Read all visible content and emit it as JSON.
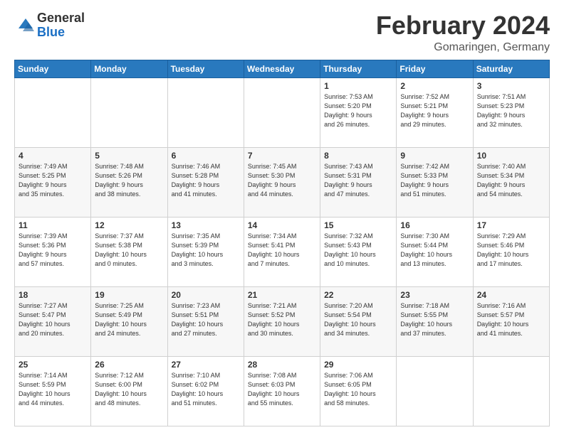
{
  "header": {
    "logo_general": "General",
    "logo_blue": "Blue",
    "title": "February 2024",
    "subtitle": "Gomaringen, Germany"
  },
  "columns": [
    "Sunday",
    "Monday",
    "Tuesday",
    "Wednesday",
    "Thursday",
    "Friday",
    "Saturday"
  ],
  "weeks": [
    [
      {
        "day": "",
        "info": ""
      },
      {
        "day": "",
        "info": ""
      },
      {
        "day": "",
        "info": ""
      },
      {
        "day": "",
        "info": ""
      },
      {
        "day": "1",
        "info": "Sunrise: 7:53 AM\nSunset: 5:20 PM\nDaylight: 9 hours\nand 26 minutes."
      },
      {
        "day": "2",
        "info": "Sunrise: 7:52 AM\nSunset: 5:21 PM\nDaylight: 9 hours\nand 29 minutes."
      },
      {
        "day": "3",
        "info": "Sunrise: 7:51 AM\nSunset: 5:23 PM\nDaylight: 9 hours\nand 32 minutes."
      }
    ],
    [
      {
        "day": "4",
        "info": "Sunrise: 7:49 AM\nSunset: 5:25 PM\nDaylight: 9 hours\nand 35 minutes."
      },
      {
        "day": "5",
        "info": "Sunrise: 7:48 AM\nSunset: 5:26 PM\nDaylight: 9 hours\nand 38 minutes."
      },
      {
        "day": "6",
        "info": "Sunrise: 7:46 AM\nSunset: 5:28 PM\nDaylight: 9 hours\nand 41 minutes."
      },
      {
        "day": "7",
        "info": "Sunrise: 7:45 AM\nSunset: 5:30 PM\nDaylight: 9 hours\nand 44 minutes."
      },
      {
        "day": "8",
        "info": "Sunrise: 7:43 AM\nSunset: 5:31 PM\nDaylight: 9 hours\nand 47 minutes."
      },
      {
        "day": "9",
        "info": "Sunrise: 7:42 AM\nSunset: 5:33 PM\nDaylight: 9 hours\nand 51 minutes."
      },
      {
        "day": "10",
        "info": "Sunrise: 7:40 AM\nSunset: 5:34 PM\nDaylight: 9 hours\nand 54 minutes."
      }
    ],
    [
      {
        "day": "11",
        "info": "Sunrise: 7:39 AM\nSunset: 5:36 PM\nDaylight: 9 hours\nand 57 minutes."
      },
      {
        "day": "12",
        "info": "Sunrise: 7:37 AM\nSunset: 5:38 PM\nDaylight: 10 hours\nand 0 minutes."
      },
      {
        "day": "13",
        "info": "Sunrise: 7:35 AM\nSunset: 5:39 PM\nDaylight: 10 hours\nand 3 minutes."
      },
      {
        "day": "14",
        "info": "Sunrise: 7:34 AM\nSunset: 5:41 PM\nDaylight: 10 hours\nand 7 minutes."
      },
      {
        "day": "15",
        "info": "Sunrise: 7:32 AM\nSunset: 5:43 PM\nDaylight: 10 hours\nand 10 minutes."
      },
      {
        "day": "16",
        "info": "Sunrise: 7:30 AM\nSunset: 5:44 PM\nDaylight: 10 hours\nand 13 minutes."
      },
      {
        "day": "17",
        "info": "Sunrise: 7:29 AM\nSunset: 5:46 PM\nDaylight: 10 hours\nand 17 minutes."
      }
    ],
    [
      {
        "day": "18",
        "info": "Sunrise: 7:27 AM\nSunset: 5:47 PM\nDaylight: 10 hours\nand 20 minutes."
      },
      {
        "day": "19",
        "info": "Sunrise: 7:25 AM\nSunset: 5:49 PM\nDaylight: 10 hours\nand 24 minutes."
      },
      {
        "day": "20",
        "info": "Sunrise: 7:23 AM\nSunset: 5:51 PM\nDaylight: 10 hours\nand 27 minutes."
      },
      {
        "day": "21",
        "info": "Sunrise: 7:21 AM\nSunset: 5:52 PM\nDaylight: 10 hours\nand 30 minutes."
      },
      {
        "day": "22",
        "info": "Sunrise: 7:20 AM\nSunset: 5:54 PM\nDaylight: 10 hours\nand 34 minutes."
      },
      {
        "day": "23",
        "info": "Sunrise: 7:18 AM\nSunset: 5:55 PM\nDaylight: 10 hours\nand 37 minutes."
      },
      {
        "day": "24",
        "info": "Sunrise: 7:16 AM\nSunset: 5:57 PM\nDaylight: 10 hours\nand 41 minutes."
      }
    ],
    [
      {
        "day": "25",
        "info": "Sunrise: 7:14 AM\nSunset: 5:59 PM\nDaylight: 10 hours\nand 44 minutes."
      },
      {
        "day": "26",
        "info": "Sunrise: 7:12 AM\nSunset: 6:00 PM\nDaylight: 10 hours\nand 48 minutes."
      },
      {
        "day": "27",
        "info": "Sunrise: 7:10 AM\nSunset: 6:02 PM\nDaylight: 10 hours\nand 51 minutes."
      },
      {
        "day": "28",
        "info": "Sunrise: 7:08 AM\nSunset: 6:03 PM\nDaylight: 10 hours\nand 55 minutes."
      },
      {
        "day": "29",
        "info": "Sunrise: 7:06 AM\nSunset: 6:05 PM\nDaylight: 10 hours\nand 58 minutes."
      },
      {
        "day": "",
        "info": ""
      },
      {
        "day": "",
        "info": ""
      }
    ]
  ]
}
